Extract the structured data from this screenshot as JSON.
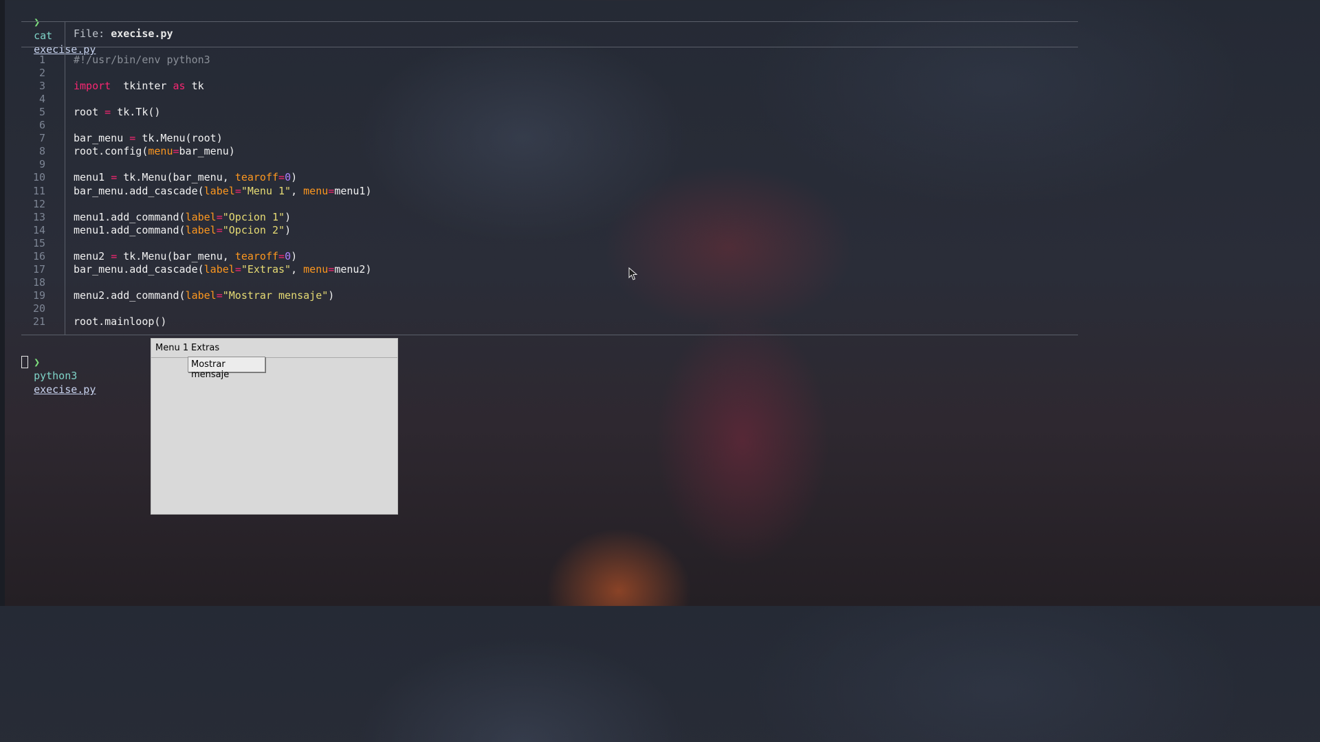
{
  "terminal": {
    "prompt_symbol": "❯",
    "command1": {
      "cmd": "cat",
      "arg": "execise.py"
    },
    "file_header": {
      "label": "File:",
      "name": "execise.py"
    },
    "command2": {
      "cmd": "python3",
      "arg": "execise.py"
    }
  },
  "code": {
    "lines": [
      {
        "n": "1",
        "segments": [
          [
            "comment",
            "#!/usr/bin/env python3"
          ]
        ]
      },
      {
        "n": "2",
        "segments": []
      },
      {
        "n": "3",
        "segments": [
          [
            "kw",
            "import"
          ],
          [
            "",
            "  tkinter "
          ],
          [
            "kw",
            "as"
          ],
          [
            "",
            " tk"
          ]
        ]
      },
      {
        "n": "4",
        "segments": []
      },
      {
        "n": "5",
        "segments": [
          [
            "",
            "root "
          ],
          [
            "op",
            "="
          ],
          [
            "",
            " tk.Tk()"
          ]
        ]
      },
      {
        "n": "6",
        "segments": []
      },
      {
        "n": "7",
        "segments": [
          [
            "",
            "bar_menu "
          ],
          [
            "op",
            "="
          ],
          [
            "",
            " tk.Menu(root)"
          ]
        ]
      },
      {
        "n": "8",
        "segments": [
          [
            "",
            "root.config("
          ],
          [
            "param",
            "menu"
          ],
          [
            "op",
            "="
          ],
          [
            "",
            "bar_menu)"
          ]
        ]
      },
      {
        "n": "9",
        "segments": []
      },
      {
        "n": "10",
        "segments": [
          [
            "",
            "menu1 "
          ],
          [
            "op",
            "="
          ],
          [
            "",
            " tk.Menu(bar_menu, "
          ],
          [
            "param",
            "tearoff"
          ],
          [
            "op",
            "="
          ],
          [
            "num",
            "0"
          ],
          [
            "",
            ")"
          ]
        ]
      },
      {
        "n": "11",
        "segments": [
          [
            "",
            "bar_menu.add_cascade("
          ],
          [
            "param",
            "label"
          ],
          [
            "op",
            "="
          ],
          [
            "str",
            "\"Menu 1\""
          ],
          [
            "",
            ", "
          ],
          [
            "param",
            "menu"
          ],
          [
            "op",
            "="
          ],
          [
            "",
            "menu1)"
          ]
        ]
      },
      {
        "n": "12",
        "segments": []
      },
      {
        "n": "13",
        "segments": [
          [
            "",
            "menu1.add_command("
          ],
          [
            "param",
            "label"
          ],
          [
            "op",
            "="
          ],
          [
            "str",
            "\"Opcion 1\""
          ],
          [
            "",
            ")"
          ]
        ]
      },
      {
        "n": "14",
        "segments": [
          [
            "",
            "menu1.add_command("
          ],
          [
            "param",
            "label"
          ],
          [
            "op",
            "="
          ],
          [
            "str",
            "\"Opcion 2\""
          ],
          [
            "",
            ")"
          ]
        ]
      },
      {
        "n": "15",
        "segments": []
      },
      {
        "n": "16",
        "segments": [
          [
            "",
            "menu2 "
          ],
          [
            "op",
            "="
          ],
          [
            "",
            " tk.Menu(bar_menu, "
          ],
          [
            "param",
            "tearoff"
          ],
          [
            "op",
            "="
          ],
          [
            "num",
            "0"
          ],
          [
            "",
            ")"
          ]
        ]
      },
      {
        "n": "17",
        "segments": [
          [
            "",
            "bar_menu.add_cascade("
          ],
          [
            "param",
            "label"
          ],
          [
            "op",
            "="
          ],
          [
            "str",
            "\"Extras\""
          ],
          [
            "",
            ", "
          ],
          [
            "param",
            "menu"
          ],
          [
            "op",
            "="
          ],
          [
            "",
            "menu2)"
          ]
        ]
      },
      {
        "n": "18",
        "segments": []
      },
      {
        "n": "19",
        "segments": [
          [
            "",
            "menu2.add_command("
          ],
          [
            "param",
            "label"
          ],
          [
            "op",
            "="
          ],
          [
            "str",
            "\"Mostrar mensaje\""
          ],
          [
            "",
            ")"
          ]
        ]
      },
      {
        "n": "20",
        "segments": []
      },
      {
        "n": "21",
        "segments": [
          [
            "",
            "root.mainloop()"
          ]
        ]
      }
    ]
  },
  "tk_window": {
    "menubar": [
      "Menu 1",
      "Extras"
    ],
    "dropdown_item": "Mostrar mensaje"
  },
  "colors": {
    "keyword": "#f92672",
    "param": "#fd971f",
    "string": "#e6db74",
    "number": "#ae81ff",
    "comment": "#8a8f98"
  }
}
